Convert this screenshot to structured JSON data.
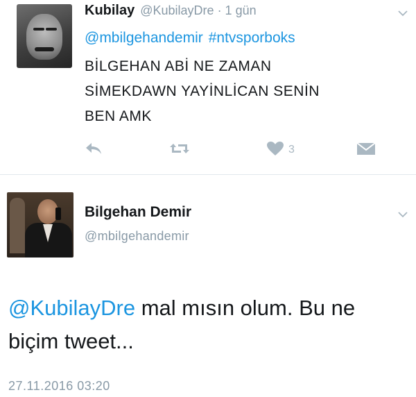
{
  "tweet_1": {
    "display_name": "Kubilay",
    "handle_time": "@KubilayDre · 1 gün",
    "mentions": [
      "@mbilgehandemir",
      "#ntvsporboks"
    ],
    "body_lines": [
      "BİLGEHAN ABİ NE ZAMAN",
      "SİMEKDAWN YAYİNLİCAN SENİN",
      "BEN AMK"
    ],
    "actions": {
      "reply_icon": "reply-icon",
      "retweet_icon": "retweet-icon",
      "like_icon": "heart-icon",
      "like_count": "3",
      "dm_icon": "envelope-icon"
    }
  },
  "tweet_2": {
    "display_name": "Bilgehan Demir",
    "handle": "@mbilgehandemir",
    "body_mention": "@KubilayDre",
    "body_text_line1": " mal mısın olum. Bu ne",
    "body_text_line2": "biçim tweet...",
    "timestamp": "27.11.2016 03:20"
  },
  "colors": {
    "link": "#1b95e0",
    "muted": "#8899a6",
    "icon": "#aab8c2",
    "text": "#14171a",
    "divider": "#e1e8ed"
  }
}
